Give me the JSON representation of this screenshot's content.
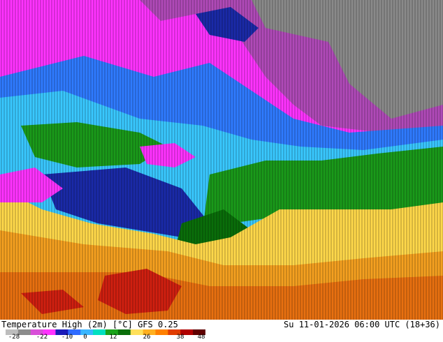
{
  "map": {
    "title": "Temperature High (2m) [°C] GFS 0.25",
    "timestamp": "Su 11-01-2026 06:00 UTC (18+36)",
    "legend": {
      "tick_labels": [
        "-28",
        "-22",
        "-10",
        "0",
        "12",
        "26",
        "38",
        "48"
      ],
      "colors": [
        "#bdbdbd",
        "#8c8c8c",
        "#d84fd8",
        "#ff33ff",
        "#1a1ab8",
        "#2f6bff",
        "#39b6ff",
        "#00e0c0",
        "#1aa31a",
        "#0a6e0a",
        "#ffe05a",
        "#ffb020",
        "#ff8000",
        "#e03c00",
        "#b00000",
        "#600000"
      ]
    },
    "field_colors": {
      "very_cold": "#8a8a8a",
      "cold_purple": "#b04ab8",
      "magenta": "#ff33ff",
      "deep_blue": "#1a2aa8",
      "blue": "#2f7bff",
      "cyan": "#39c8ff",
      "green": "#1a9a1a",
      "dark_green": "#0a6e0a",
      "yellow": "#ffd84a",
      "orange": "#f5a020",
      "dark_orange": "#e87010",
      "red": "#d02010"
    }
  }
}
